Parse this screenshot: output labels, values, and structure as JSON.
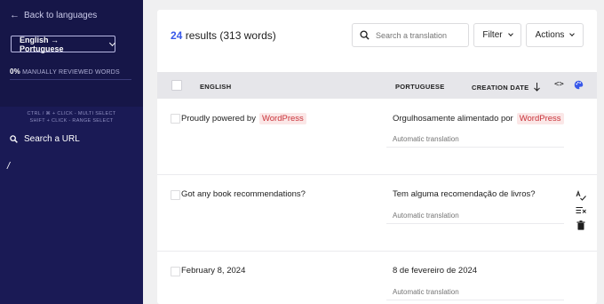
{
  "sidebar": {
    "back_label": "Back to languages",
    "language_pair": "English → Portuguese",
    "reviewed_percent": "0%",
    "reviewed_label": "MANUALLY REVIEWED WORDS",
    "reviewed_fraction": 0,
    "hint_multi": "CTRL / ⌘ + CLICK - MULTI SELECT",
    "hint_range": "SHIFT + CLICK - RANGE SELECT",
    "search_url_label": "Search a URL",
    "current_path": "/"
  },
  "toolbar": {
    "results_count": "24",
    "results_text": "results (313 words)",
    "search_placeholder": "Search a translation",
    "filter_label": "Filter",
    "actions_label": "Actions"
  },
  "table": {
    "columns": {
      "source": "ENGLISH",
      "target": "PORTUGUESE",
      "date": "CREATION DATE"
    },
    "rows": [
      {
        "source_text": "Proudly powered by",
        "source_tag": "WordPress",
        "target_text": "Orgulhosamente alimentado por",
        "target_tag": "WordPress",
        "status": "Automatic translation"
      },
      {
        "source_text": "Got any book recommendations?",
        "target_text": "Tem alguma recomendação de livros?",
        "status": "Automatic translation"
      },
      {
        "source_text": "February 8, 2024",
        "target_text": "8 de fevereiro de 2024",
        "status": "Automatic translation"
      }
    ]
  },
  "colors": {
    "sidebar_bg": "#1a1a55",
    "accent": "#3858e9",
    "tag_bg": "#fbe7e7",
    "tag_text": "#c9333a"
  }
}
